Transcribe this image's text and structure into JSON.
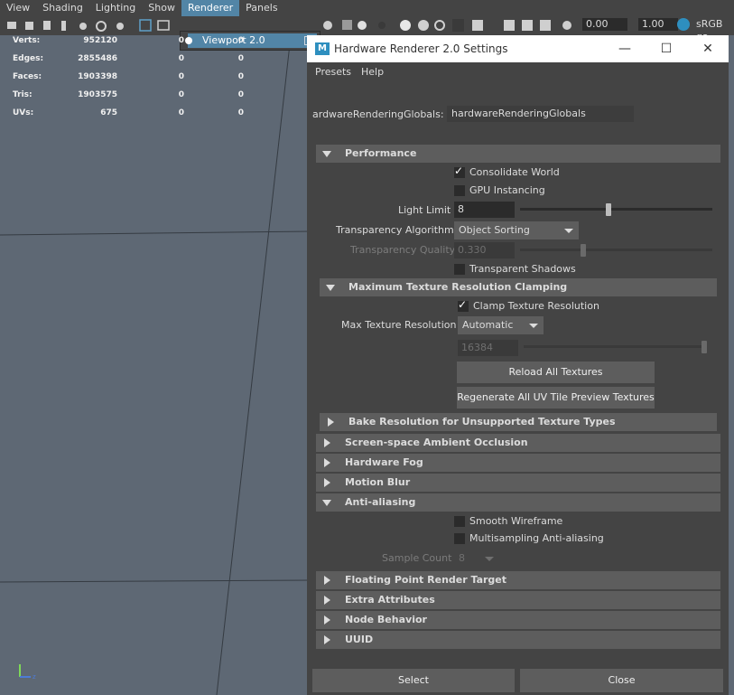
{
  "menubar": {
    "items": [
      {
        "label": "View"
      },
      {
        "label": "Shading"
      },
      {
        "label": "Lighting"
      },
      {
        "label": "Show"
      },
      {
        "label": "Renderer"
      },
      {
        "label": "Panels"
      }
    ]
  },
  "toolbar": {
    "exposure_value": "0.00",
    "gamma_value": "1.00",
    "color_space_label": "sRGB ga"
  },
  "renderer_menu": {
    "item_label": "Viewport 2.0"
  },
  "hud": {
    "rows": [
      {
        "label": "Verts:",
        "v1": "952120",
        "v2": "0",
        "v3": "0"
      },
      {
        "label": "Edges:",
        "v1": "2855486",
        "v2": "0",
        "v3": "0"
      },
      {
        "label": "Faces:",
        "v1": "1903398",
        "v2": "0",
        "v3": "0"
      },
      {
        "label": "Tris:",
        "v1": "1903575",
        "v2": "0",
        "v3": "0"
      },
      {
        "label": "UVs:",
        "v1": "675",
        "v2": "0",
        "v3": "0"
      }
    ]
  },
  "window": {
    "icon_letter": "M",
    "title": "Hardware Renderer 2.0 Settings",
    "minimize": "—",
    "maximize": "☐",
    "close": "✕",
    "menu": [
      {
        "label": "Presets"
      },
      {
        "label": "Help"
      }
    ],
    "globals_label": "ardwareRenderingGlobals:",
    "globals_value": "hardwareRenderingGlobals",
    "performance": {
      "header": "Performance",
      "consolidate_world": "Consolidate World",
      "gpu_instancing": "GPU Instancing",
      "light_limit_label": "Light Limit",
      "light_limit_value": "8",
      "transparency_algorithm_label": "Transparency Algorithm",
      "transparency_algorithm_value": "Object Sorting",
      "transparency_quality_label": "Transparency Quality",
      "transparency_quality_value": "0.330",
      "transparent_shadows": "Transparent Shadows"
    },
    "max_texture": {
      "header": "Maximum Texture Resolution Clamping",
      "clamp_label": "Clamp Texture Resolution",
      "max_res_label": "Max Texture Resolution",
      "max_res_value": "Automatic",
      "res_field_value": "16384",
      "reload_button": "Reload All Textures",
      "regenerate_button": "Regenerate All UV Tile Preview Textures"
    },
    "bake_header": "Bake Resolution for Unsupported Texture Types",
    "ssao_header": "Screen-space Ambient Occlusion",
    "fog_header": "Hardware Fog",
    "motion_blur_header": "Motion Blur",
    "anti_aliasing": {
      "header": "Anti-aliasing",
      "smooth_wireframe": "Smooth Wireframe",
      "multisampling": "Multisampling Anti-aliasing",
      "sample_count_label": "Sample Count",
      "sample_count_value": "8"
    },
    "floating_point_header": "Floating Point Render Target",
    "extra_attributes_header": "Extra Attributes",
    "node_behavior_header": "Node Behavior",
    "uuid_header": "UUID",
    "select_button": "Select",
    "close_button": "Close"
  },
  "colors": {
    "accent": "#5285a6",
    "viewport_bg": "#5e6874",
    "panel_bg": "#444444",
    "section_bg": "#5d5d5d"
  }
}
